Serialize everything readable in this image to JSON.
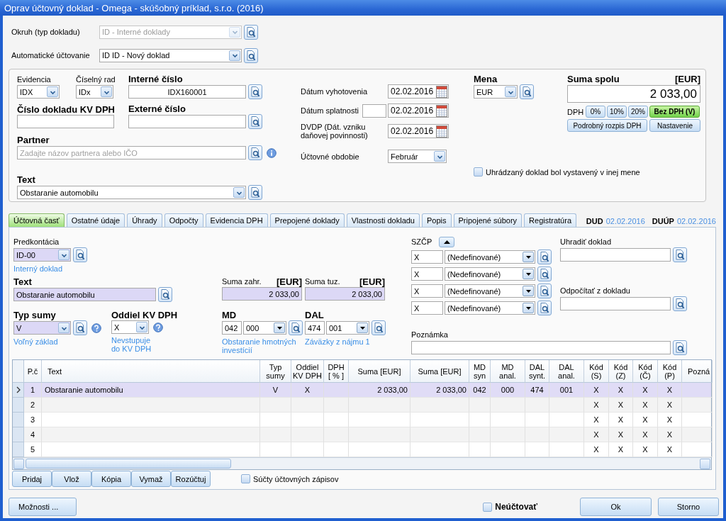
{
  "window": {
    "title": "Oprav účtovný doklad - Omega - skúšobný príklad, s.r.o. (2016)"
  },
  "top_fields": [
    {
      "label": "Okruh (typ dokladu)",
      "value": "ID - Interné doklady",
      "disabled": true
    },
    {
      "label": "Automatické účtovanie",
      "value": "ID ID - Nový doklad",
      "disabled": false
    }
  ],
  "header": {
    "evidencia": {
      "label": "Evidencia",
      "value": "IDX"
    },
    "ciselny_rad": {
      "label": "Číselný rad",
      "value": "IDx"
    },
    "interne_cislo": {
      "label": "Interné číslo",
      "value": "IDX160001"
    },
    "cislo_kv_dph": {
      "label": "Číslo dokladu KV DPH"
    },
    "externe_cislo": {
      "label": "Externé číslo"
    },
    "partner": {
      "label": "Partner",
      "placeholder": "Zadajte názov partnera alebo IČO"
    },
    "text": {
      "label": "Text",
      "value": "Obstaranie automobilu"
    },
    "dates": [
      {
        "kind": "plain",
        "label": "Dátum vyhotovenia",
        "value": "02.02.2016"
      },
      {
        "kind": "with_days",
        "label": "Dátum splatnosti",
        "value": "02.02.2016"
      },
      {
        "kind": "plain",
        "label": "DVDP (Dát. vzniku\ndaňovej povinnosti)",
        "value": "02.02.2016"
      }
    ],
    "period": {
      "label": "Účtovné obdobie",
      "value": "Február"
    },
    "currency": {
      "label": "Mena",
      "value": "EUR"
    },
    "foreign_currency": {
      "label": "Uhrádzaný doklad bol vystavený v inej mene",
      "checked": false
    },
    "total": {
      "label": "Suma spolu",
      "unit": "[EUR]",
      "value": "2 033,00"
    },
    "vat": {
      "label": "DPH",
      "rates": [
        {
          "label": "0%",
          "selected": false
        },
        {
          "label": "10%",
          "selected": false
        },
        {
          "label": "20%",
          "selected": false
        },
        {
          "label": "Bez DPH (V)",
          "selected": true
        }
      ],
      "buttons": [
        "Podrobný rozpis DPH",
        "Nastavenie"
      ]
    }
  },
  "tabs": [
    {
      "label": "Účtovná časť",
      "selected": true
    },
    {
      "label": "Ostatné údaje",
      "selected": false
    },
    {
      "label": "Úhrady",
      "selected": false
    },
    {
      "label": "Odpočty",
      "selected": false
    },
    {
      "label": "Evidencia DPH",
      "selected": false
    },
    {
      "label": "Prepojené doklady",
      "selected": false
    },
    {
      "label": "Vlastnosti dokladu",
      "selected": false
    },
    {
      "label": "Popis",
      "selected": false
    },
    {
      "label": "Pripojené súbory",
      "selected": false
    },
    {
      "label": "Registratúra",
      "selected": false
    }
  ],
  "doc_dates": [
    {
      "label": "DUD",
      "value": "02.02.2016"
    },
    {
      "label": "DUÚP",
      "value": "02.02.2016"
    }
  ],
  "entry": {
    "predkontacia": {
      "label": "Predkontácia",
      "value": "ID-00",
      "note": "Interný doklad"
    },
    "text": {
      "label": "Text",
      "value": "Obstaranie automobilu"
    },
    "suma_zahr": {
      "label": "Suma zahr.",
      "unit": "[EUR]",
      "value": "2 033,00"
    },
    "suma_tuz": {
      "label": "Suma tuz.",
      "unit": "[EUR]",
      "value": "2 033,00"
    },
    "typ_sumy": {
      "label": "Typ sumy",
      "value": "V",
      "note": "Voľný základ"
    },
    "oddiel": {
      "label": "Oddiel KV DPH",
      "value": "X",
      "note": "Nevstupuje do KV DPH"
    },
    "md": {
      "label": "MD",
      "synt": "042",
      "anal": "000",
      "note": "Obstaranie hmotných investícií"
    },
    "dal": {
      "label": "DAL",
      "synt": "474",
      "anal": "001",
      "note": "Záväzky z nájmu 1"
    },
    "szcp": {
      "label": "SZČP",
      "rows": [
        {
          "code": "X",
          "value": "(Nedefinované)"
        },
        {
          "code": "X",
          "value": "(Nedefinované)"
        },
        {
          "code": "X",
          "value": "(Nedefinované)"
        },
        {
          "code": "X",
          "value": "(Nedefinované)"
        }
      ]
    },
    "uhradit": {
      "label": "Uhradiť doklad"
    },
    "odpocitat": {
      "label": "Odpočítať z dokladu"
    },
    "poznamka": {
      "label": "Poznámka"
    }
  },
  "table": {
    "columns": [
      {
        "label": "P.č",
        "kind": "index"
      },
      {
        "label": "Text",
        "kind": "text"
      },
      {
        "label": "Typ\nsumy",
        "kind": "code"
      },
      {
        "label": "Oddiel\nKV DPH",
        "kind": "code"
      },
      {
        "label": "DPH\n[ % ]",
        "kind": "code"
      },
      {
        "label": "Suma [EUR]",
        "kind": "amount"
      },
      {
        "label": "Suma [EUR]",
        "kind": "amount"
      },
      {
        "label": "MD\nsyn",
        "kind": "code"
      },
      {
        "label": "MD\nanal.",
        "kind": "code"
      },
      {
        "label": "DAL\nsynt.",
        "kind": "code"
      },
      {
        "label": "DAL\nanal.",
        "kind": "code"
      },
      {
        "label": "Kód\n(S)",
        "kind": "code"
      },
      {
        "label": "Kód\n(Z)",
        "kind": "code"
      },
      {
        "label": "Kód\n(Č)",
        "kind": "code"
      },
      {
        "label": "Kód\n(P)",
        "kind": "code"
      },
      {
        "label": "Pozná",
        "kind": "text"
      }
    ],
    "rows": [
      {
        "selected": true,
        "cells": [
          "1",
          "Obstaranie automobilu",
          "V",
          "X",
          null,
          "2 033,00",
          "2 033,00",
          "042",
          "000",
          "474",
          "001",
          "X",
          "X",
          "X",
          "X",
          null
        ]
      },
      {
        "selected": false,
        "cells": [
          "2",
          null,
          null,
          null,
          null,
          null,
          null,
          null,
          null,
          null,
          null,
          "X",
          "X",
          "X",
          "X",
          null
        ]
      },
      {
        "selected": false,
        "cells": [
          "3",
          null,
          null,
          null,
          null,
          null,
          null,
          null,
          null,
          null,
          null,
          "X",
          "X",
          "X",
          "X",
          null
        ]
      },
      {
        "selected": false,
        "cells": [
          "4",
          null,
          null,
          null,
          null,
          null,
          null,
          null,
          null,
          null,
          null,
          "X",
          "X",
          "X",
          "X",
          null
        ]
      },
      {
        "selected": false,
        "cells": [
          "5",
          null,
          null,
          null,
          null,
          null,
          null,
          null,
          null,
          null,
          null,
          "X",
          "X",
          "X",
          "X",
          null
        ]
      }
    ]
  },
  "table_buttons": [
    "Pridaj",
    "Vlož",
    "Kópia",
    "Vymaž",
    "Rozúčtuj"
  ],
  "sums_checkbox": {
    "label": "Súčty účtovných zápisov",
    "checked": false
  },
  "footer": {
    "options": "Možnosti ...",
    "no_post": {
      "label": "Neúčtovať",
      "checked": false
    },
    "ok": "Ok",
    "cancel": "Storno"
  }
}
